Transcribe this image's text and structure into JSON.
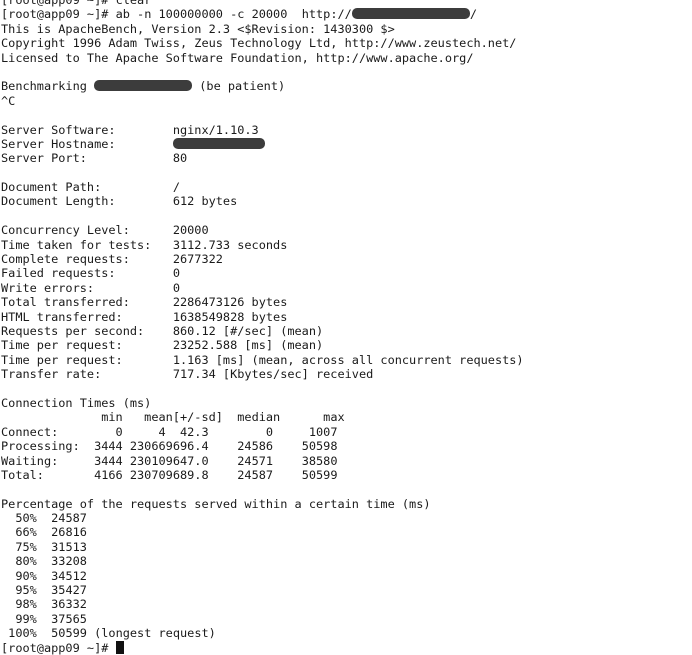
{
  "terminal": {
    "prompt": "[root@app09 ~]#",
    "clear_cmd": "clear",
    "command_pre": "ab -n 100000000 -c 20000  http://",
    "command_post": "/",
    "banner": {
      "line1": "This is ApacheBench, Version 2.3 <$Revision: 1430300 $>",
      "line2": "Copyright 1996 Adam Twiss, Zeus Technology Ltd, http://www.zeustech.net/",
      "line3": "Licensed to The Apache Software Foundation, http://www.apache.org/"
    },
    "benchmarking_pre": "Benchmarking",
    "benchmarking_post": "(be patient)",
    "interrupt": "^C",
    "server": {
      "software_label": "Server Software:",
      "software_value": "nginx/1.10.3",
      "hostname_label": "Server Hostname:",
      "port_label": "Server Port:",
      "port_value": "80"
    },
    "document": {
      "path_label": "Document Path:",
      "path_value": "/",
      "length_label": "Document Length:",
      "length_value": "612 bytes"
    },
    "stats": [
      {
        "label": "Concurrency Level:",
        "value": "20000"
      },
      {
        "label": "Time taken for tests:",
        "value": "3112.733 seconds"
      },
      {
        "label": "Complete requests:",
        "value": "2677322"
      },
      {
        "label": "Failed requests:",
        "value": "0"
      },
      {
        "label": "Write errors:",
        "value": "0"
      },
      {
        "label": "Total transferred:",
        "value": "2286473126 bytes"
      },
      {
        "label": "HTML transferred:",
        "value": "1638549828 bytes"
      },
      {
        "label": "Requests per second:",
        "value": "860.12 [#/sec] (mean)"
      },
      {
        "label": "Time per request:",
        "value": "23252.588 [ms] (mean)"
      },
      {
        "label": "Time per request:",
        "value": "1.163 [ms] (mean, across all concurrent requests)"
      },
      {
        "label": "Transfer rate:",
        "value": "717.34 [Kbytes/sec] received"
      }
    ],
    "connection_times": {
      "title": "Connection Times (ms)",
      "headers": [
        "min",
        "mean[+/-sd]",
        "median",
        "max"
      ],
      "rows": [
        {
          "label": "Connect:",
          "min": "0",
          "mean": "4",
          "sd": "42.3",
          "median": "0",
          "max": "1007"
        },
        {
          "label": "Processing:",
          "min": "3444",
          "mean": "23066",
          "sd": "9696.4",
          "median": "24586",
          "max": "50598"
        },
        {
          "label": "Waiting:",
          "min": "3444",
          "mean": "23010",
          "sd": "9647.0",
          "median": "24571",
          "max": "38580"
        },
        {
          "label": "Total:",
          "min": "4166",
          "mean": "23070",
          "sd": "9689.8",
          "median": "24587",
          "max": "50599"
        }
      ]
    },
    "percentiles": {
      "title": "Percentage of the requests served within a certain time (ms)",
      "rows": [
        {
          "pct": "50%",
          "ms": "24587"
        },
        {
          "pct": "66%",
          "ms": "26816"
        },
        {
          "pct": "75%",
          "ms": "31513"
        },
        {
          "pct": "80%",
          "ms": "33208"
        },
        {
          "pct": "90%",
          "ms": "34512"
        },
        {
          "pct": "95%",
          "ms": "35427"
        },
        {
          "pct": "98%",
          "ms": "36332"
        },
        {
          "pct": "99%",
          "ms": "37565"
        },
        {
          "pct": "100%",
          "ms": "50599",
          "note": "(longest request)"
        }
      ]
    }
  }
}
